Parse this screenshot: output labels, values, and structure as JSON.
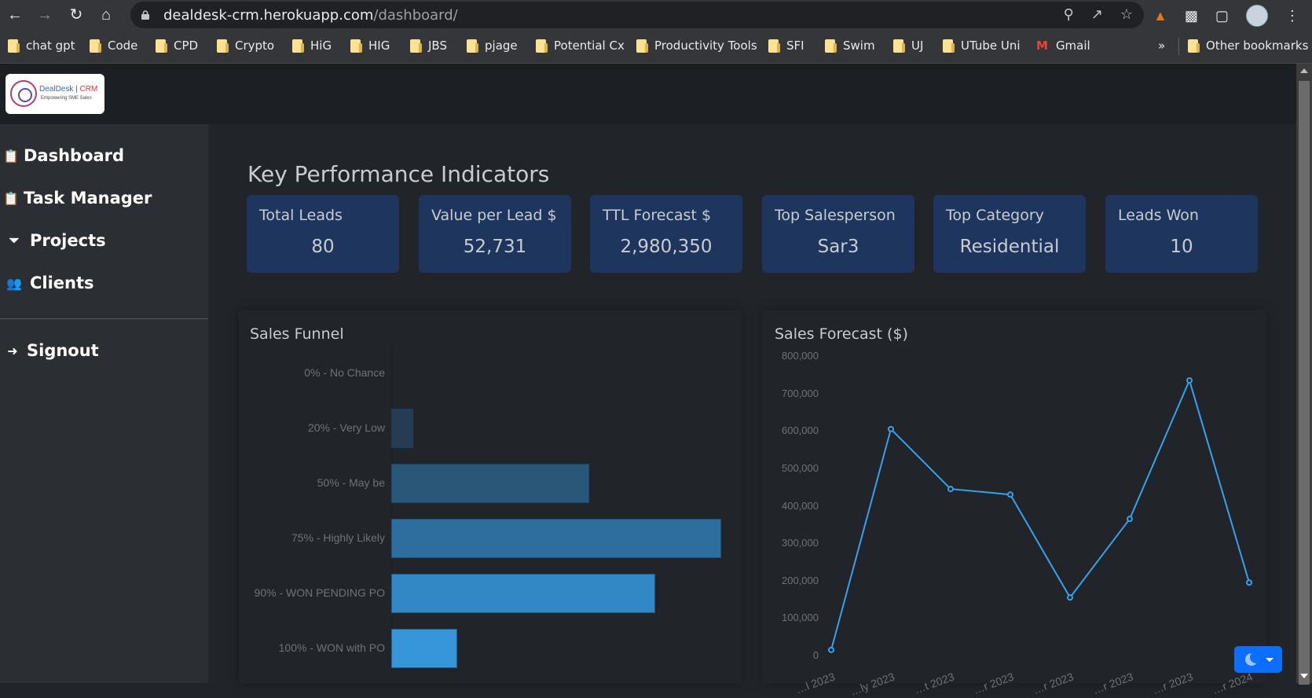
{
  "browser": {
    "url_host": "dealdesk-crm.herokuapp.com",
    "url_path": "/dashboard/",
    "bookmarks": [
      "chat gpt",
      "Code",
      "CPD",
      "Crypto",
      "HiG",
      "HIG",
      "JBS",
      "pjage",
      "Potential Cx",
      "Productivity Tools",
      "SFI",
      "Swim",
      "UJ",
      "UTube Uni",
      "Gmail"
    ],
    "overflow_label": "»",
    "other_bookmarks": "Other bookmarks"
  },
  "logo": {
    "title": "DealDesk |",
    "title_accent": "CRM",
    "subtitle": "Empowering SME Sales"
  },
  "sidebar": {
    "items": [
      {
        "label": "Dashboard",
        "icon": "clipboard-check-icon"
      },
      {
        "label": "Task Manager",
        "icon": "clipboard-check-icon"
      },
      {
        "label": "Projects",
        "icon": "funnel-dollar-icon"
      },
      {
        "label": "Clients",
        "icon": "users-icon"
      }
    ],
    "signout": {
      "label": "Signout",
      "icon": "sign-in-icon"
    }
  },
  "kpi": {
    "title": "Key Performance Indicators",
    "cards": [
      {
        "label": "Total Leads",
        "value": "80"
      },
      {
        "label": "Value per Lead $",
        "value": "52,731"
      },
      {
        "label": "TTL Forecast $",
        "value": "2,980,350"
      },
      {
        "label": "Top Salesperson",
        "value": "Sar3"
      },
      {
        "label": "Top Category",
        "value": "Residential"
      },
      {
        "label": "Leads Won",
        "value": "10"
      }
    ]
  },
  "chart_data": [
    {
      "type": "bar",
      "orientation": "horizontal",
      "title": "Sales Funnel",
      "categories": [
        "0% - No Chance",
        "20% - Very Low",
        "50% - May be",
        "75% - Highly Likely",
        "90% - WON PENDING PO",
        "100% - WON with PO"
      ],
      "values": [
        0,
        2,
        18,
        30,
        24,
        6
      ],
      "colors": [
        "#1f3448",
        "#253d53",
        "#2a5778",
        "#2d6e9f",
        "#3288c5",
        "#3796d8"
      ],
      "grid": false
    },
    {
      "type": "line",
      "title": "Sales Forecast ($)",
      "x": [
        "…l 2023",
        "…ly 2023",
        "…t 2023",
        "…r 2023",
        "…r 2023",
        "…r 2023",
        "…r 2023",
        "…r 2024"
      ],
      "values": [
        15000,
        605000,
        445000,
        430000,
        155000,
        365000,
        735000,
        195000
      ],
      "yticks": [
        "0",
        "100,000",
        "200,000",
        "300,000",
        "400,000",
        "500,000",
        "600,000",
        "700,000",
        "800,000"
      ],
      "ylim": [
        0,
        800000
      ],
      "color": "#36a2eb",
      "grid": false
    }
  ],
  "theme_toggle": {
    "icon": "moon-icon"
  }
}
